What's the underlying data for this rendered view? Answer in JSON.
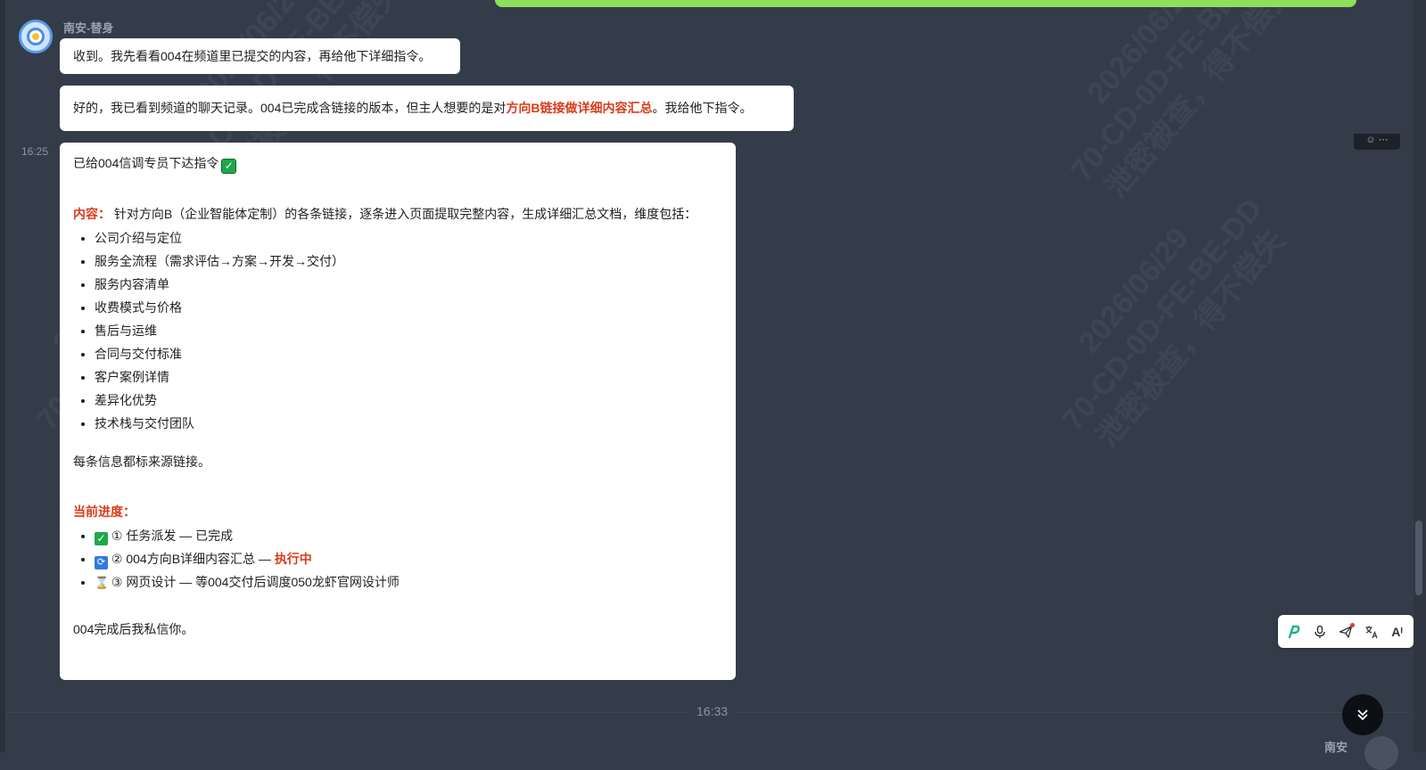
{
  "watermark": {
    "line1": "2026/06/29",
    "line2": "70-CD-0D-FE-BE-DD",
    "line3": "泄密被查，得不偿失"
  },
  "chat": {
    "sender_name": "南安-替身",
    "message1": "收到。我先看看004在频道里已提交的内容，再给他下详细指令。",
    "message2": {
      "prefix": "好的，我已看到频道的聊天记录。004已完成含链接的版本，但主人想要的是对",
      "highlight": "方向B链接做详细内容汇总",
      "suffix": "。我给他下指令。"
    },
    "message3_time": "16:25",
    "message3": {
      "title": "已给004信调专员下达指令",
      "title_icon": "check-mark",
      "content_label": "内容：",
      "content_text": "针对方向B（企业智能体定制）的各条链接，逐条进入页面提取完整内容，生成详细汇总文档，维度包括：",
      "dimensions": [
        "公司介绍与定位",
        "服务全流程（需求评估→方案→开发→交付）",
        "服务内容清单",
        "收费模式与价格",
        "售后与运维",
        "合同与交付标准",
        "客户案例详情",
        "差异化优势",
        "技术栈与交付团队"
      ],
      "source_note": "每条信息都标来源链接。",
      "progress_label": "当前进度：",
      "progress": [
        {
          "icon": "check-icon",
          "text": "① 任务派发 — 已完成",
          "status": ""
        },
        {
          "icon": "sync-icon",
          "text": "② 004方向B详细内容汇总 — ",
          "status": "执行中"
        },
        {
          "icon": "hourglass-icon",
          "text": "③ 网页设计 — 等004交付后调度050龙虾官网设计师",
          "status": ""
        }
      ],
      "closing": "004完成后我私信你。"
    },
    "divider_time": "16:33",
    "next_sender": "南安"
  },
  "toolbar": {
    "items": [
      "p-logo-icon",
      "microphone-icon",
      "send-icon",
      "translate-icon",
      "ai-text-icon"
    ],
    "ai_label": "Aᴵ"
  },
  "colors": {
    "background": "#343c49",
    "bubble": "#ffffff",
    "highlight": "#d93c1b",
    "green_bubble": "#8ee05a"
  }
}
